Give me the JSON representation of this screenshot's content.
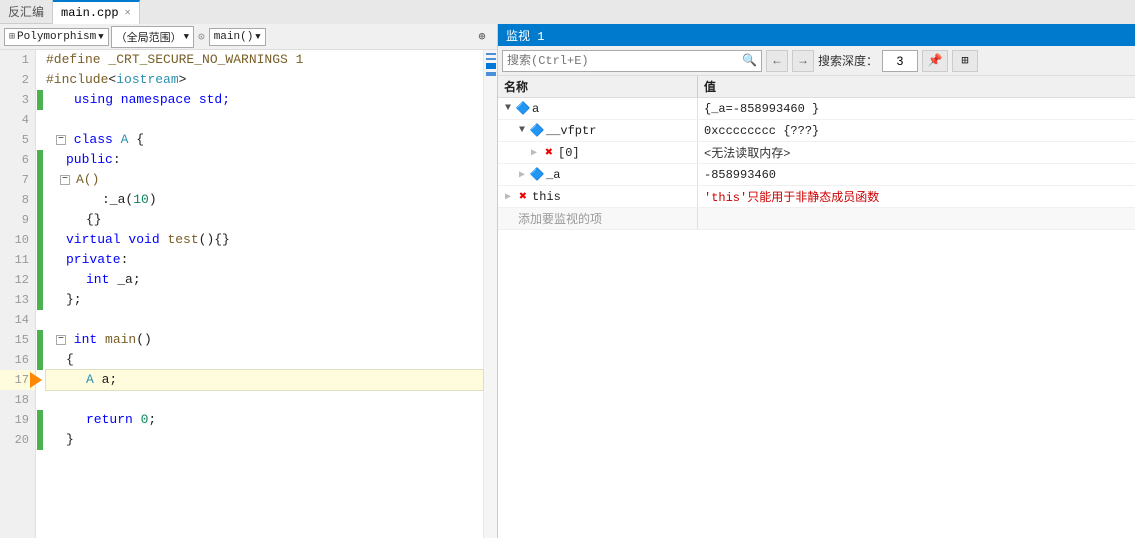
{
  "tabs": {
    "inactive_label": "反汇编",
    "active_label": "main.cpp",
    "close_symbol": "✕"
  },
  "toolbar": {
    "polymorphism_label": "Polymorphism",
    "scope_label": "（全局范围）",
    "func_label": "main()",
    "arrow_symbol": "⊕"
  },
  "code": {
    "lines": [
      {
        "num": 1,
        "indent": "",
        "tokens": [
          {
            "t": "prep",
            "v": "#define _CRT_SECURE_NO_WARNINGS 1"
          }
        ],
        "bp": false,
        "arrow": false
      },
      {
        "num": 2,
        "indent": "",
        "tokens": [
          {
            "t": "prep",
            "v": "#include"
          },
          {
            "t": "plain",
            "v": "<"
          },
          {
            "t": "kw3",
            "v": "iostream"
          },
          {
            "t": "plain",
            "v": ">"
          }
        ],
        "bp": false,
        "arrow": false
      },
      {
        "num": 3,
        "indent": "    ",
        "tokens": [
          {
            "t": "kw",
            "v": "using namespace std;"
          }
        ],
        "bp": false,
        "arrow": false
      },
      {
        "num": 4,
        "indent": "",
        "tokens": [],
        "bp": false,
        "arrow": false
      },
      {
        "num": 5,
        "indent": "",
        "tokens": [
          {
            "t": "plain",
            "v": "⊟ "
          },
          {
            "t": "kw",
            "v": "class "
          },
          {
            "t": "kw3",
            "v": "A "
          },
          {
            "t": "plain",
            "v": "{"
          }
        ],
        "bp": false,
        "arrow": false
      },
      {
        "num": 6,
        "indent": "    ",
        "tokens": [
          {
            "t": "kw",
            "v": "public"
          },
          {
            "t": "plain",
            "v": ":"
          }
        ],
        "bp": false,
        "arrow": false
      },
      {
        "num": 7,
        "indent": "        ",
        "tokens": [
          {
            "t": "plain",
            "v": "⊟     "
          },
          {
            "t": "func",
            "v": "A()"
          }
        ],
        "bp": false,
        "arrow": false
      },
      {
        "num": 8,
        "indent": "            ",
        "tokens": [
          {
            "t": "plain",
            "v": ":"
          },
          {
            "t": "plain",
            "v": "_a("
          },
          {
            "t": "num",
            "v": "10"
          },
          {
            "t": "plain",
            "v": ")"
          }
        ],
        "bp": false,
        "arrow": false
      },
      {
        "num": 9,
        "indent": "        ",
        "tokens": [
          {
            "t": "plain",
            "v": "        {}"
          }
        ],
        "bp": false,
        "arrow": false
      },
      {
        "num": 10,
        "indent": "        ",
        "tokens": [
          {
            "t": "kw",
            "v": "virtual "
          },
          {
            "t": "kw",
            "v": "void "
          },
          {
            "t": "func",
            "v": "test"
          },
          {
            "t": "plain",
            "v": "(){}"
          }
        ],
        "bp": false,
        "arrow": false
      },
      {
        "num": 11,
        "indent": "    ",
        "tokens": [
          {
            "t": "kw",
            "v": "private"
          },
          {
            "t": "plain",
            "v": ":"
          }
        ],
        "bp": false,
        "arrow": false
      },
      {
        "num": 12,
        "indent": "        ",
        "tokens": [
          {
            "t": "kw",
            "v": "int "
          },
          {
            "t": "plain",
            "v": "_a;"
          }
        ],
        "bp": false,
        "arrow": false
      },
      {
        "num": 13,
        "indent": "    ",
        "tokens": [
          {
            "t": "plain",
            "v": "    };"
          }
        ],
        "bp": false,
        "arrow": false
      },
      {
        "num": 14,
        "indent": "",
        "tokens": [],
        "bp": false,
        "arrow": false
      },
      {
        "num": 15,
        "indent": "",
        "tokens": [
          {
            "t": "plain",
            "v": "⊟ "
          },
          {
            "t": "kw",
            "v": "int "
          },
          {
            "t": "func",
            "v": "main"
          },
          {
            "t": "plain",
            "v": "()"
          }
        ],
        "bp": false,
        "arrow": false
      },
      {
        "num": 16,
        "indent": "    ",
        "tokens": [
          {
            "t": "plain",
            "v": "    {"
          }
        ],
        "bp": false,
        "arrow": false
      },
      {
        "num": 17,
        "indent": "        ",
        "tokens": [
          {
            "t": "kw3",
            "v": "A "
          },
          {
            "t": "plain",
            "v": "a;"
          }
        ],
        "bp": false,
        "arrow": true,
        "current": true
      },
      {
        "num": 18,
        "indent": "",
        "tokens": [],
        "bp": false,
        "arrow": false
      },
      {
        "num": 19,
        "indent": "        ",
        "tokens": [
          {
            "t": "kw",
            "v": "return "
          },
          {
            "t": "num",
            "v": "0"
          },
          {
            "t": "plain",
            "v": ";"
          }
        ],
        "bp": false,
        "arrow": false
      },
      {
        "num": 20,
        "indent": "    ",
        "tokens": [
          {
            "t": "plain",
            "v": "    }"
          }
        ],
        "bp": false,
        "arrow": false
      }
    ]
  },
  "watch": {
    "panel_title": "监视 1",
    "search_placeholder": "搜索(Ctrl+E)",
    "depth_label": "搜索深度：",
    "depth_value": "3",
    "nav_back": "←",
    "nav_forward": "→",
    "col_name": "名称",
    "col_value": "值",
    "items": [
      {
        "id": "a",
        "level": 0,
        "expanded": true,
        "icon": "obj",
        "name": "a",
        "value": "{_a=-858993460 }",
        "children": [
          {
            "id": "vfptr",
            "level": 1,
            "expanded": true,
            "icon": "obj",
            "name": "__vfptr",
            "value": "0xcccccccc {???}",
            "children": [
              {
                "id": "vfptr0",
                "level": 2,
                "expanded": false,
                "icon": "error",
                "name": "[0]",
                "value": "<无法读取内存>",
                "children": []
              }
            ]
          },
          {
            "id": "_a",
            "level": 1,
            "expanded": false,
            "icon": "obj",
            "name": "_a",
            "value": "-858993460",
            "children": []
          }
        ]
      },
      {
        "id": "this",
        "level": 0,
        "expanded": false,
        "icon": "error",
        "name": "this",
        "value": "'this'只能用于非静态成员函数",
        "value_color": "red",
        "children": []
      },
      {
        "id": "add",
        "level": 0,
        "expanded": false,
        "icon": "none",
        "name": "添加要监视的项",
        "value": "",
        "is_add": true,
        "children": []
      }
    ]
  }
}
